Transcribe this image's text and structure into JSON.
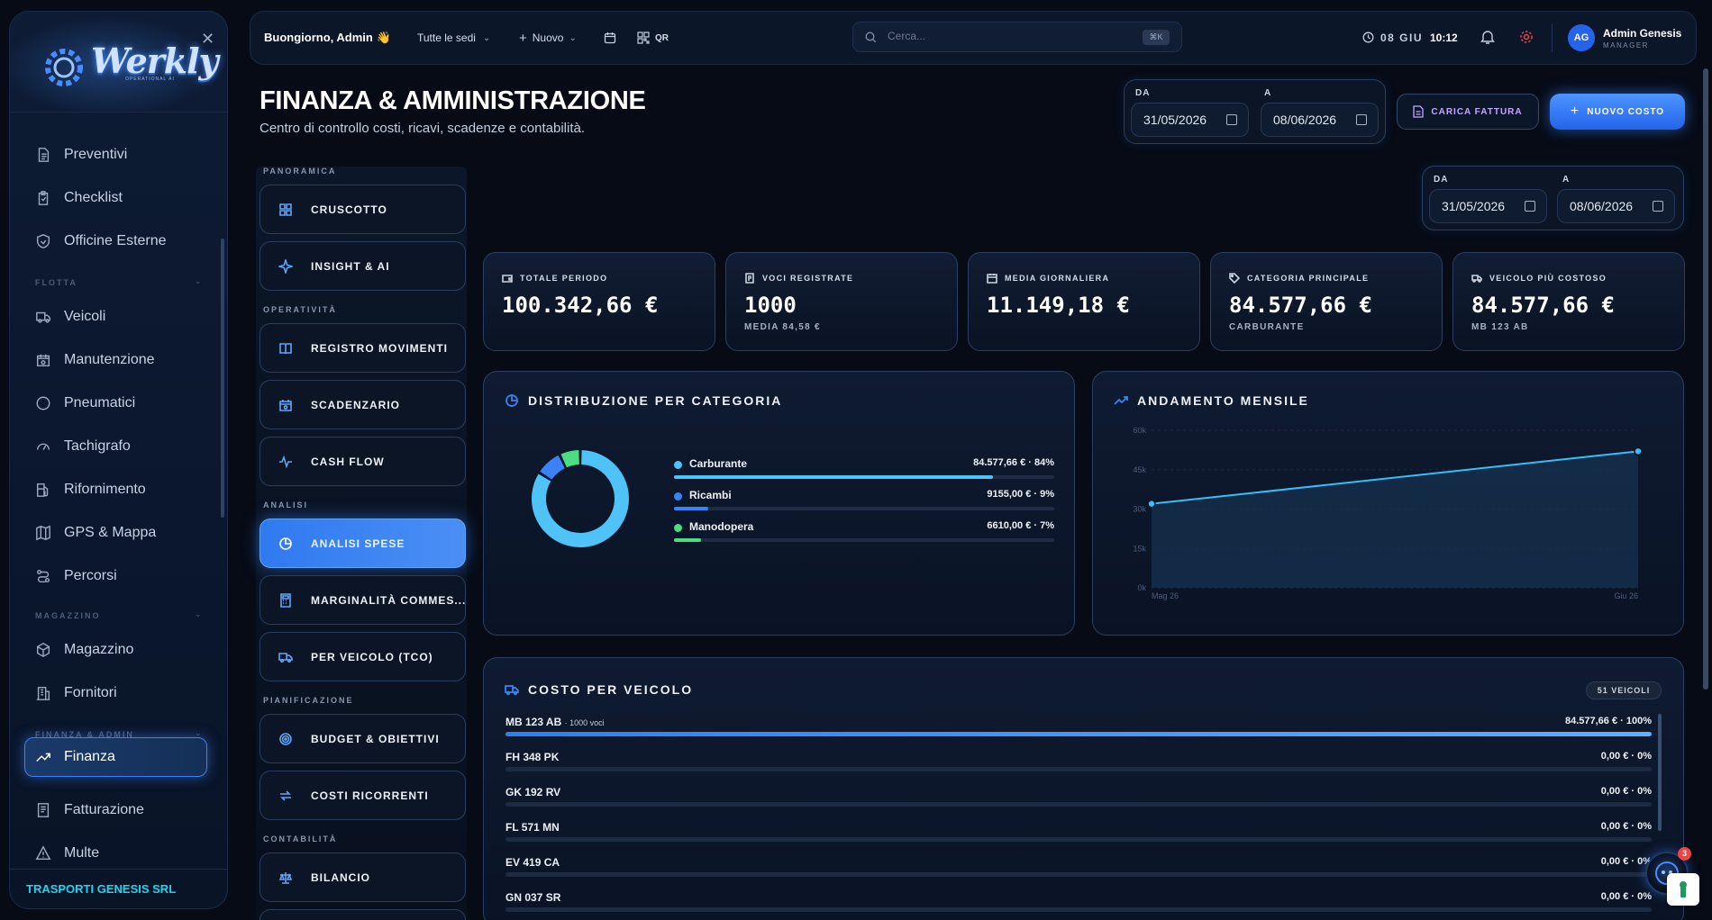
{
  "sidebar": {
    "brand": "Werkly",
    "brand_sub": "OPERATIONAL AI",
    "close_icon": "close-icon",
    "items_top": [
      {
        "label": "Preventivi",
        "icon": "document-icon"
      },
      {
        "label": "Checklist",
        "icon": "clipboard-icon"
      },
      {
        "label": "Officine Esterne",
        "icon": "wrench-shield-icon"
      }
    ],
    "section_flotta": "FLOTTA",
    "items_flotta": [
      {
        "label": "Veicoli",
        "icon": "truck-icon"
      },
      {
        "label": "Manutenzione",
        "icon": "calendar-wrench-icon"
      },
      {
        "label": "Pneumatici",
        "icon": "circle-icon"
      },
      {
        "label": "Tachigrafo",
        "icon": "gauge-icon"
      },
      {
        "label": "Rifornimento",
        "icon": "fuel-icon"
      },
      {
        "label": "GPS & Mappa",
        "icon": "map-icon"
      },
      {
        "label": "Percorsi",
        "icon": "route-icon"
      }
    ],
    "section_magazzino": "MAGAZZINO",
    "items_magazzino": [
      {
        "label": "Magazzino",
        "icon": "box-icon"
      },
      {
        "label": "Fornitori",
        "icon": "building-icon"
      }
    ],
    "section_finanza": "FINANZA & ADMIN",
    "items_finanza": [
      {
        "label": "Finanza",
        "icon": "trend-up-icon",
        "active": true
      },
      {
        "label": "Fatturazione",
        "icon": "invoice-icon"
      },
      {
        "label": "Multe",
        "icon": "warning-icon"
      }
    ],
    "company": "TRASPORTI GENESIS SRL",
    "accent": "#22d3ee"
  },
  "topbar": {
    "greeting": "Buongiorno, Admin 👋",
    "location_select": "Tutte le sedi",
    "new_label": "Nuovo",
    "qr_label": "QR",
    "search_placeholder": "Cerca...",
    "search_shortcut": "⌘K",
    "date": "08 GIU",
    "time": "10:12",
    "user_initials": "AG",
    "user_name": "Admin Genesis",
    "user_role": "MANAGER"
  },
  "header": {
    "title": "FINANZA & AMMINISTRAZIONE",
    "subtitle": "Centro di controllo costi, ricavi, scadenze e contabilità.",
    "range_from_label": "DA",
    "range_to_label": "A",
    "range_from": "31/05/2026",
    "range_to": "08/06/2026",
    "upload_invoice": "CARICA FATTURA",
    "new_cost": "NUOVO COSTO"
  },
  "filter": {
    "from_label": "DA",
    "to_label": "A",
    "from": "31/05/2026",
    "to": "08/06/2026"
  },
  "subnav": {
    "panoramica": "PANORAMICA",
    "operativita": "OPERATIVITÀ",
    "analisi": "ANALISI",
    "pianificazione": "PIANIFICAZIONE",
    "contabilita": "CONTABILITÀ",
    "cruscotto": "CRUSCOTTO",
    "insight": "INSIGHT & AI",
    "registro": "REGISTRO MOVIMENTI",
    "scadenzario": "SCADENZARIO",
    "cashflow": "CASH FLOW",
    "analisi_spese": "ANALISI SPESE",
    "marginalita": "MARGINALITÀ COMMES...",
    "per_veicolo": "PER VEICOLO (TCO)",
    "budget": "BUDGET & OBIETTIVI",
    "ricorrenti": "COSTI RICORRENTI",
    "bilancio": "BILANCIO"
  },
  "kpis": [
    {
      "label": "TOTALE PERIODO",
      "value": "100.342,66 €",
      "sub": "",
      "icon": "wallet-icon"
    },
    {
      "label": "VOCI REGISTRATE",
      "value": "1000",
      "sub": "MEDIA 84,58 €",
      "icon": "receipt-icon"
    },
    {
      "label": "MEDIA GIORNALIERA",
      "value": "11.149,18 €",
      "sub": "",
      "icon": "calendar-icon"
    },
    {
      "label": "CATEGORIA PRINCIPALE",
      "value": "84.577,66 €",
      "sub": "CARBURANTE",
      "icon": "tag-icon"
    },
    {
      "label": "VEICOLO PIÙ COSTOSO",
      "value": "84.577,66 €",
      "sub": "MB 123 AB",
      "icon": "truck-icon"
    }
  ],
  "distribution": {
    "title": "DISTRIBUZIONE PER CATEGORIA",
    "items": [
      {
        "name": "Carburante",
        "value": "84.577,66 € · 84%",
        "pct": 84,
        "color": "#4fc3f7"
      },
      {
        "name": "Ricambi",
        "value": "9155,00 € · 9%",
        "pct": 9,
        "color": "#3b82f6"
      },
      {
        "name": "Manodopera",
        "value": "6610,00 € · 7%",
        "pct": 7,
        "color": "#4ade80"
      }
    ]
  },
  "chart_data": {
    "type": "area",
    "title": "ANDAMENTO MENSILE",
    "x": [
      "Mag 26",
      "Giu 26"
    ],
    "series": [
      {
        "values": [
          32000,
          52000
        ]
      }
    ],
    "yticks": [
      "60k",
      "45k",
      "30k",
      "15k",
      "0k"
    ],
    "ylim": [
      0,
      60000
    ],
    "grid": true
  },
  "vehicles": {
    "title": "COSTO PER VEICOLO",
    "count_badge": "51 VEICOLI",
    "rows": [
      {
        "plate": "MB 123 AB",
        "voci": "· 1000 voci",
        "value": "84.577,66 € · 100%",
        "pct": 100
      },
      {
        "plate": "FH 348 PK",
        "voci": "",
        "value": "0,00 € · 0%",
        "pct": 0
      },
      {
        "plate": "GK 192 RV",
        "voci": "",
        "value": "0,00 € · 0%",
        "pct": 0
      },
      {
        "plate": "FL 571 MN",
        "voci": "",
        "value": "0,00 € · 0%",
        "pct": 0
      },
      {
        "plate": "EV 419 CA",
        "voci": "",
        "value": "0,00 € · 0%",
        "pct": 0
      },
      {
        "plate": "GN 037 SR",
        "voci": "",
        "value": "0,00 € · 0%",
        "pct": 0
      }
    ]
  },
  "assistant": {
    "notification_count": "3"
  }
}
